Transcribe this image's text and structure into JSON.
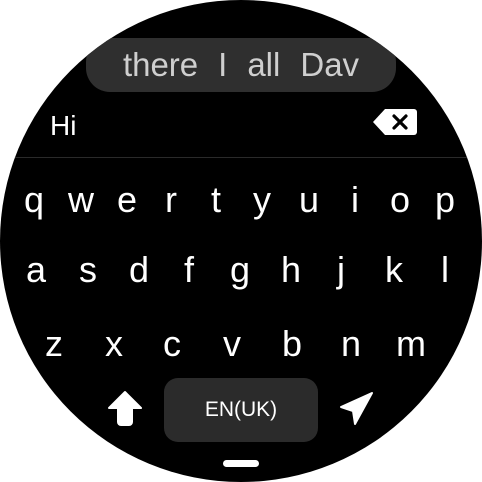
{
  "suggestions": [
    "there",
    "I",
    "all",
    "Dav"
  ],
  "input": {
    "value": "Hi"
  },
  "keyboard": {
    "row1": [
      "q",
      "w",
      "e",
      "r",
      "t",
      "y",
      "u",
      "i",
      "o",
      "p"
    ],
    "row2": [
      "a",
      "s",
      "d",
      "f",
      "g",
      "h",
      "j",
      "k",
      "l"
    ],
    "row3": [
      "z",
      "x",
      "c",
      "v",
      "b",
      "n",
      "m"
    ],
    "space_label": "EN(UK)"
  },
  "icons": {
    "backspace": "backspace-icon",
    "shift": "shift-arrow-up-icon",
    "send": "send-arrow-icon"
  },
  "colors": {
    "background": "#000000",
    "suggestion_bar": "#2f2f2f",
    "space_key": "#2b2b2b",
    "text": "#ffffff",
    "suggestion_text": "#cfcfcf"
  }
}
